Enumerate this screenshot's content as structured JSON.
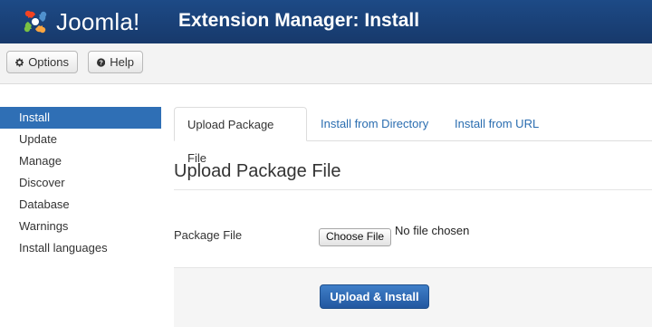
{
  "header": {
    "logo_text": "Joomla!",
    "logo_icon": "joomla-logo-icon",
    "title": "Extension Manager: Install"
  },
  "toolbar": {
    "options_label": "Options",
    "options_icon": "gear-icon",
    "help_label": "Help",
    "help_icon": "question-icon"
  },
  "sidebar": {
    "items": [
      {
        "label": "Install",
        "active": true
      },
      {
        "label": "Update",
        "active": false
      },
      {
        "label": "Manage",
        "active": false
      },
      {
        "label": "Discover",
        "active": false
      },
      {
        "label": "Database",
        "active": false
      },
      {
        "label": "Warnings",
        "active": false
      },
      {
        "label": "Install languages",
        "active": false
      }
    ]
  },
  "main": {
    "tabs": [
      {
        "label": "Upload Package File",
        "active": true
      },
      {
        "label": "Install from Directory",
        "active": false
      },
      {
        "label": "Install from URL",
        "active": false
      }
    ],
    "section_title": "Upload Package File",
    "package_file_label": "Package File",
    "choose_file_label": "Choose File",
    "no_file_text": "No file chosen",
    "submit_label": "Upload & Install"
  },
  "colors": {
    "header_bg": "#1d4a86",
    "active_sidebar": "#2f6fb5",
    "link": "#2a6db0",
    "primary_button": "#2b63ab"
  }
}
